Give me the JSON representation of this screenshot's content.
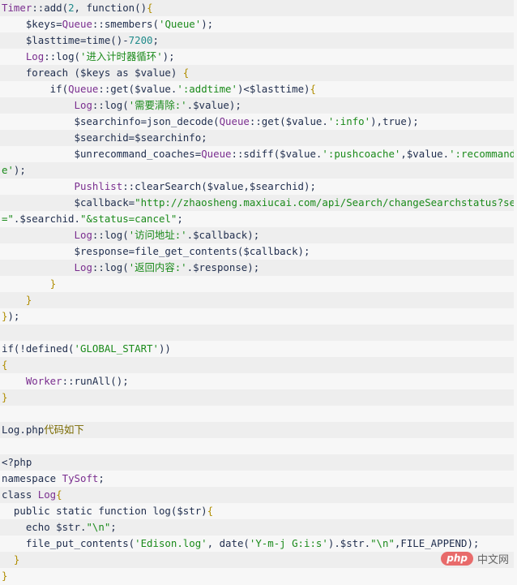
{
  "code": {
    "language": "php",
    "lines": [
      [
        {
          "t": "cls",
          "v": "Timer"
        },
        {
          "t": "txt",
          "v": "::add("
        },
        {
          "t": "num",
          "v": "2"
        },
        {
          "t": "txt",
          "v": ", function()"
        },
        {
          "t": "brc",
          "v": "{"
        }
      ],
      [
        {
          "t": "txt",
          "v": "    $keys="
        },
        {
          "t": "cls",
          "v": "Queue"
        },
        {
          "t": "txt",
          "v": "::smembers("
        },
        {
          "t": "str",
          "v": "'Queue'"
        },
        {
          "t": "txt",
          "v": ");"
        }
      ],
      [
        {
          "t": "txt",
          "v": "    $lasttime=time()-"
        },
        {
          "t": "num",
          "v": "7200"
        },
        {
          "t": "txt",
          "v": ";"
        }
      ],
      [
        {
          "t": "txt",
          "v": "    "
        },
        {
          "t": "cls",
          "v": "Log"
        },
        {
          "t": "txt",
          "v": "::log("
        },
        {
          "t": "str",
          "v": "'进入计时器循环'"
        },
        {
          "t": "txt",
          "v": ");"
        }
      ],
      [
        {
          "t": "txt",
          "v": "    foreach ($keys as $value) "
        },
        {
          "t": "brc",
          "v": "{"
        }
      ],
      [
        {
          "t": "txt",
          "v": "        if("
        },
        {
          "t": "cls",
          "v": "Queue"
        },
        {
          "t": "txt",
          "v": "::get($value."
        },
        {
          "t": "str",
          "v": "':addtime'"
        },
        {
          "t": "txt",
          "v": ")<$lasttime)"
        },
        {
          "t": "brc",
          "v": "{"
        }
      ],
      [
        {
          "t": "txt",
          "v": "            "
        },
        {
          "t": "cls",
          "v": "Log"
        },
        {
          "t": "txt",
          "v": "::log("
        },
        {
          "t": "str",
          "v": "'需要清除:'"
        },
        {
          "t": "txt",
          "v": ".$value);"
        }
      ],
      [
        {
          "t": "txt",
          "v": "            $searchinfo=json_decode("
        },
        {
          "t": "cls",
          "v": "Queue"
        },
        {
          "t": "txt",
          "v": "::get($value."
        },
        {
          "t": "str",
          "v": "':info'"
        },
        {
          "t": "txt",
          "v": "),true);"
        }
      ],
      [
        {
          "t": "txt",
          "v": "            $searchid=$searchinfo;"
        }
      ],
      [
        {
          "t": "txt",
          "v": "            $unrecommand_coaches="
        },
        {
          "t": "cls",
          "v": "Queue"
        },
        {
          "t": "txt",
          "v": "::sdiff($value."
        },
        {
          "t": "str",
          "v": "':pushcoache'"
        },
        {
          "t": "txt",
          "v": ",$value."
        },
        {
          "t": "str",
          "v": "':recommandcoach"
        }
      ],
      [
        {
          "t": "str",
          "v": "e'"
        },
        {
          "t": "txt",
          "v": ");"
        }
      ],
      [
        {
          "t": "txt",
          "v": "            "
        },
        {
          "t": "cls",
          "v": "Pushlist"
        },
        {
          "t": "txt",
          "v": "::clearSearch($value,$searchid);"
        }
      ],
      [
        {
          "t": "txt",
          "v": "            $callback="
        },
        {
          "t": "str",
          "v": "\"http://zhaosheng.maxiucai.com/api/Search/changeSearchstatus?searchid"
        }
      ],
      [
        {
          "t": "str",
          "v": "=\""
        },
        {
          "t": "txt",
          "v": ".$searchid."
        },
        {
          "t": "str",
          "v": "\"&status=cancel\""
        },
        {
          "t": "txt",
          "v": ";"
        }
      ],
      [
        {
          "t": "txt",
          "v": "            "
        },
        {
          "t": "cls",
          "v": "Log"
        },
        {
          "t": "txt",
          "v": "::log("
        },
        {
          "t": "str",
          "v": "'访问地址:'"
        },
        {
          "t": "txt",
          "v": ".$callback);"
        }
      ],
      [
        {
          "t": "txt",
          "v": "            $response=file_get_contents($callback);"
        }
      ],
      [
        {
          "t": "txt",
          "v": "            "
        },
        {
          "t": "cls",
          "v": "Log"
        },
        {
          "t": "txt",
          "v": "::log("
        },
        {
          "t": "str",
          "v": "'返回内容:'"
        },
        {
          "t": "txt",
          "v": ".$response);"
        }
      ],
      [
        {
          "t": "txt",
          "v": "        "
        },
        {
          "t": "brc",
          "v": "}"
        }
      ],
      [
        {
          "t": "txt",
          "v": "    "
        },
        {
          "t": "brc",
          "v": "}"
        }
      ],
      [
        {
          "t": "brc",
          "v": "}"
        },
        {
          "t": "txt",
          "v": ");"
        }
      ],
      [],
      [
        {
          "t": "txt",
          "v": "if(!defined("
        },
        {
          "t": "str",
          "v": "'GLOBAL_START'"
        },
        {
          "t": "txt",
          "v": "))"
        }
      ],
      [
        {
          "t": "brc",
          "v": "{"
        }
      ],
      [
        {
          "t": "txt",
          "v": "    "
        },
        {
          "t": "cls",
          "v": "Worker"
        },
        {
          "t": "txt",
          "v": "::runAll();"
        }
      ],
      [
        {
          "t": "brc",
          "v": "}"
        }
      ],
      [],
      [
        {
          "t": "txt",
          "v": "Log.php"
        },
        {
          "t": "cn",
          "v": "代码如下"
        }
      ],
      [],
      [
        {
          "t": "txt",
          "v": "<?php"
        }
      ],
      [
        {
          "t": "txt",
          "v": "namespace "
        },
        {
          "t": "cls",
          "v": "TySoft"
        },
        {
          "t": "txt",
          "v": ";"
        }
      ],
      [
        {
          "t": "txt",
          "v": "class "
        },
        {
          "t": "cls",
          "v": "Log"
        },
        {
          "t": "brc",
          "v": "{"
        }
      ],
      [
        {
          "t": "txt",
          "v": "  public static function log($str)"
        },
        {
          "t": "brc",
          "v": "{"
        }
      ],
      [
        {
          "t": "txt",
          "v": "    echo $str."
        },
        {
          "t": "str",
          "v": "\"\\n\""
        },
        {
          "t": "txt",
          "v": ";"
        }
      ],
      [
        {
          "t": "txt",
          "v": "    file_put_contents("
        },
        {
          "t": "str",
          "v": "'Edison.log'"
        },
        {
          "t": "txt",
          "v": ", date("
        },
        {
          "t": "str",
          "v": "'Y-m-j G:i:s'"
        },
        {
          "t": "txt",
          "v": ").$str."
        },
        {
          "t": "str",
          "v": "\"\\n\""
        },
        {
          "t": "txt",
          "v": ",FILE_APPEND);"
        }
      ],
      [
        {
          "t": "txt",
          "v": "  "
        },
        {
          "t": "brc",
          "v": "}"
        }
      ],
      [
        {
          "t": "brc",
          "v": "}"
        }
      ]
    ]
  },
  "watermark": {
    "logo_text": "php",
    "site_text": "中文网"
  }
}
